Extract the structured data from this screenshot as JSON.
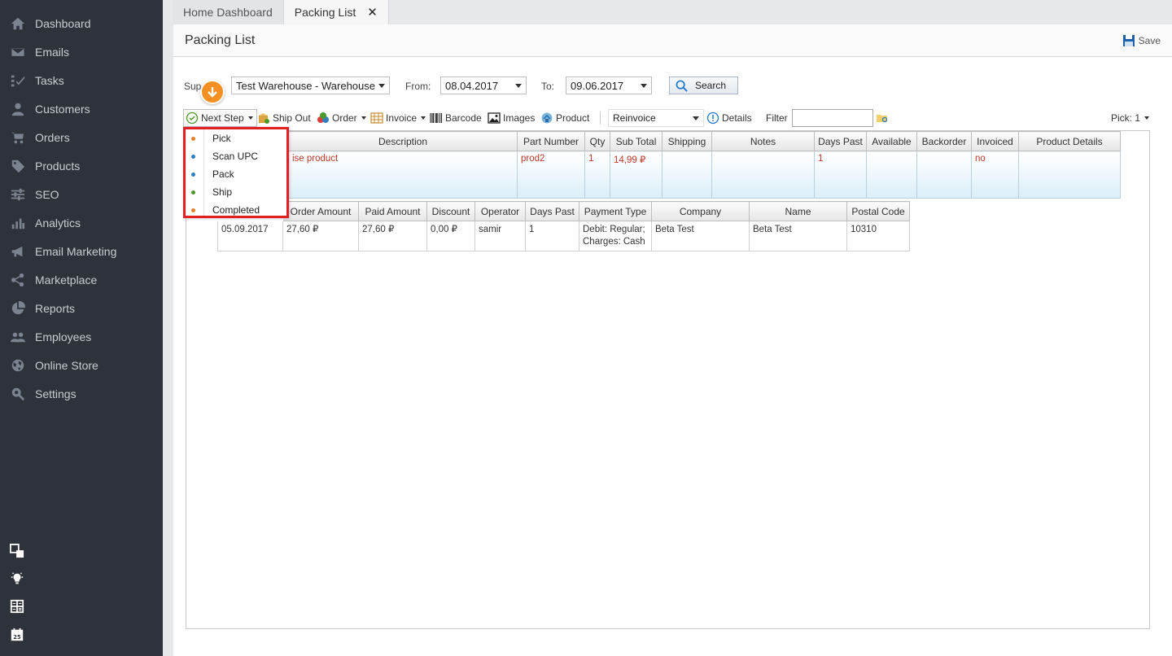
{
  "sidebar": {
    "items": [
      {
        "label": "Dashboard",
        "icon": "home-icon"
      },
      {
        "label": "Emails",
        "icon": "envelope-icon"
      },
      {
        "label": "Tasks",
        "icon": "tasks-icon"
      },
      {
        "label": "Customers",
        "icon": "user-icon"
      },
      {
        "label": "Orders",
        "icon": "cart-icon"
      },
      {
        "label": "Products",
        "icon": "tag-icon"
      },
      {
        "label": "SEO",
        "icon": "sliders-icon"
      },
      {
        "label": "Analytics",
        "icon": "bar-chart-icon"
      },
      {
        "label": "Email Marketing",
        "icon": "megaphone-icon"
      },
      {
        "label": "Marketplace",
        "icon": "share-icon"
      },
      {
        "label": "Reports",
        "icon": "pie-chart-icon"
      },
      {
        "label": "Employees",
        "icon": "users-icon"
      },
      {
        "label": "Online Store",
        "icon": "globe-icon"
      },
      {
        "label": "Settings",
        "icon": "settings-search-icon"
      }
    ],
    "tools": [
      "windows-icon",
      "lightbulb-icon",
      "calculator-icon",
      "calendar-icon"
    ],
    "calendar_day": "25"
  },
  "tabs": [
    {
      "label": "Home Dashboard",
      "active": false
    },
    {
      "label": "Packing List",
      "active": true,
      "close": "✕"
    }
  ],
  "page": {
    "title": "Packing List",
    "save_label": "Save"
  },
  "filters": {
    "supplier_label": "Sup",
    "supplier_value": "Test Warehouse - Warehouse",
    "from_label": "From:",
    "from_value": "08.04.2017",
    "to_label": "To:",
    "to_value": "09.06.2017",
    "search_label": "Search"
  },
  "toolbar": {
    "next_step": "Next Step",
    "ship_out": "Ship Out",
    "order": "Order",
    "invoice": "Invoice",
    "barcode": "Barcode",
    "images": "Images",
    "product": "Product",
    "reinvoice": "Reinvoice",
    "details": "Details",
    "filter_label": "Filter",
    "filter_value": "",
    "pick": "Pick: 1"
  },
  "next_step_menu": [
    {
      "label": "Pick",
      "color": "#e67e22"
    },
    {
      "label": "Scan UPC",
      "color": "#2f7fc1"
    },
    {
      "label": "Pack",
      "color": "#2f7fc1"
    },
    {
      "label": "Ship",
      "color": "#4c9a2a"
    },
    {
      "label": "Completed",
      "color": "#e67e22"
    }
  ],
  "master_table": {
    "columns": [
      "Description",
      "Part Number",
      "Qty",
      "Sub Total",
      "Shipping",
      "Notes",
      "Days Past",
      "Available",
      "Backorder",
      "Invoiced",
      "Product Details"
    ],
    "rows": [
      [
        "ise product",
        "prod2",
        "1",
        "14,99 ₽",
        "",
        "",
        "1",
        "",
        "",
        "no",
        ""
      ]
    ]
  },
  "detail_table": {
    "columns": [
      "Order Amount",
      "Paid Amount",
      "Discount",
      "Operator",
      "Days Past",
      "Payment Type",
      "Company",
      "Name",
      "Postal Code"
    ],
    "rows": [
      [
        "05.09.2017",
        "27,60 ₽",
        "27,60 ₽",
        "0,00 ₽",
        "samir",
        "1",
        "Debit: Regular; Charges: Cash",
        "Beta Test",
        "Beta Test",
        "10310"
      ]
    ]
  },
  "colors": {
    "sidebar_bg": "#2e333b",
    "accent_orange": "#f39021",
    "highlight_red": "#e31e24",
    "row_text_red": "#c0392b"
  }
}
